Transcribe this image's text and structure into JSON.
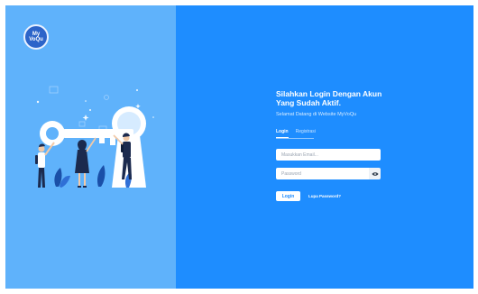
{
  "logo": {
    "line1": "My",
    "line2": "VoQu"
  },
  "login": {
    "title_line1": "Silahkan Login Dengan Akun",
    "title_line2": "Yang Sudah Aktif.",
    "subtitle": "Selamat Datang di Website MyVoQu",
    "tabs": [
      {
        "label": "Login",
        "active": true
      },
      {
        "label": "Registrasi",
        "active": false
      }
    ],
    "email_placeholder": "Masukkan Email...",
    "password_placeholder": "Password",
    "login_button": "Login",
    "forgot_link": "Lupa Password?"
  },
  "icons": {
    "eye": "eye-icon",
    "key": "key-illustration"
  },
  "colors": {
    "left_panel": "#5fb2fb",
    "right_panel": "#1e8dff",
    "logo": "#2c64c9",
    "figure_dark": "#1b2a4e"
  }
}
